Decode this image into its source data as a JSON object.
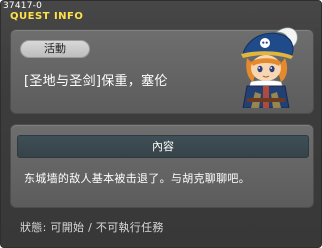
{
  "window": {
    "corner_id": "37417-0",
    "title": "QUEST INFO"
  },
  "quest": {
    "badge_label": "活動",
    "name": "[圣地与圣剑]保重，塞伦",
    "npc_portrait": "pirate-captain-character-icon"
  },
  "content": {
    "header": "內容",
    "text": "东城墙的敌人基本被击退了。与胡克聊聊吧。"
  },
  "status": {
    "text": "狀態: 可開始 / 不可執行任務"
  },
  "colors": {
    "title": "#ffe14a",
    "window_bg": "#3d3d3d",
    "panel_bg": "#666666",
    "header_bar": "#3a474e"
  }
}
